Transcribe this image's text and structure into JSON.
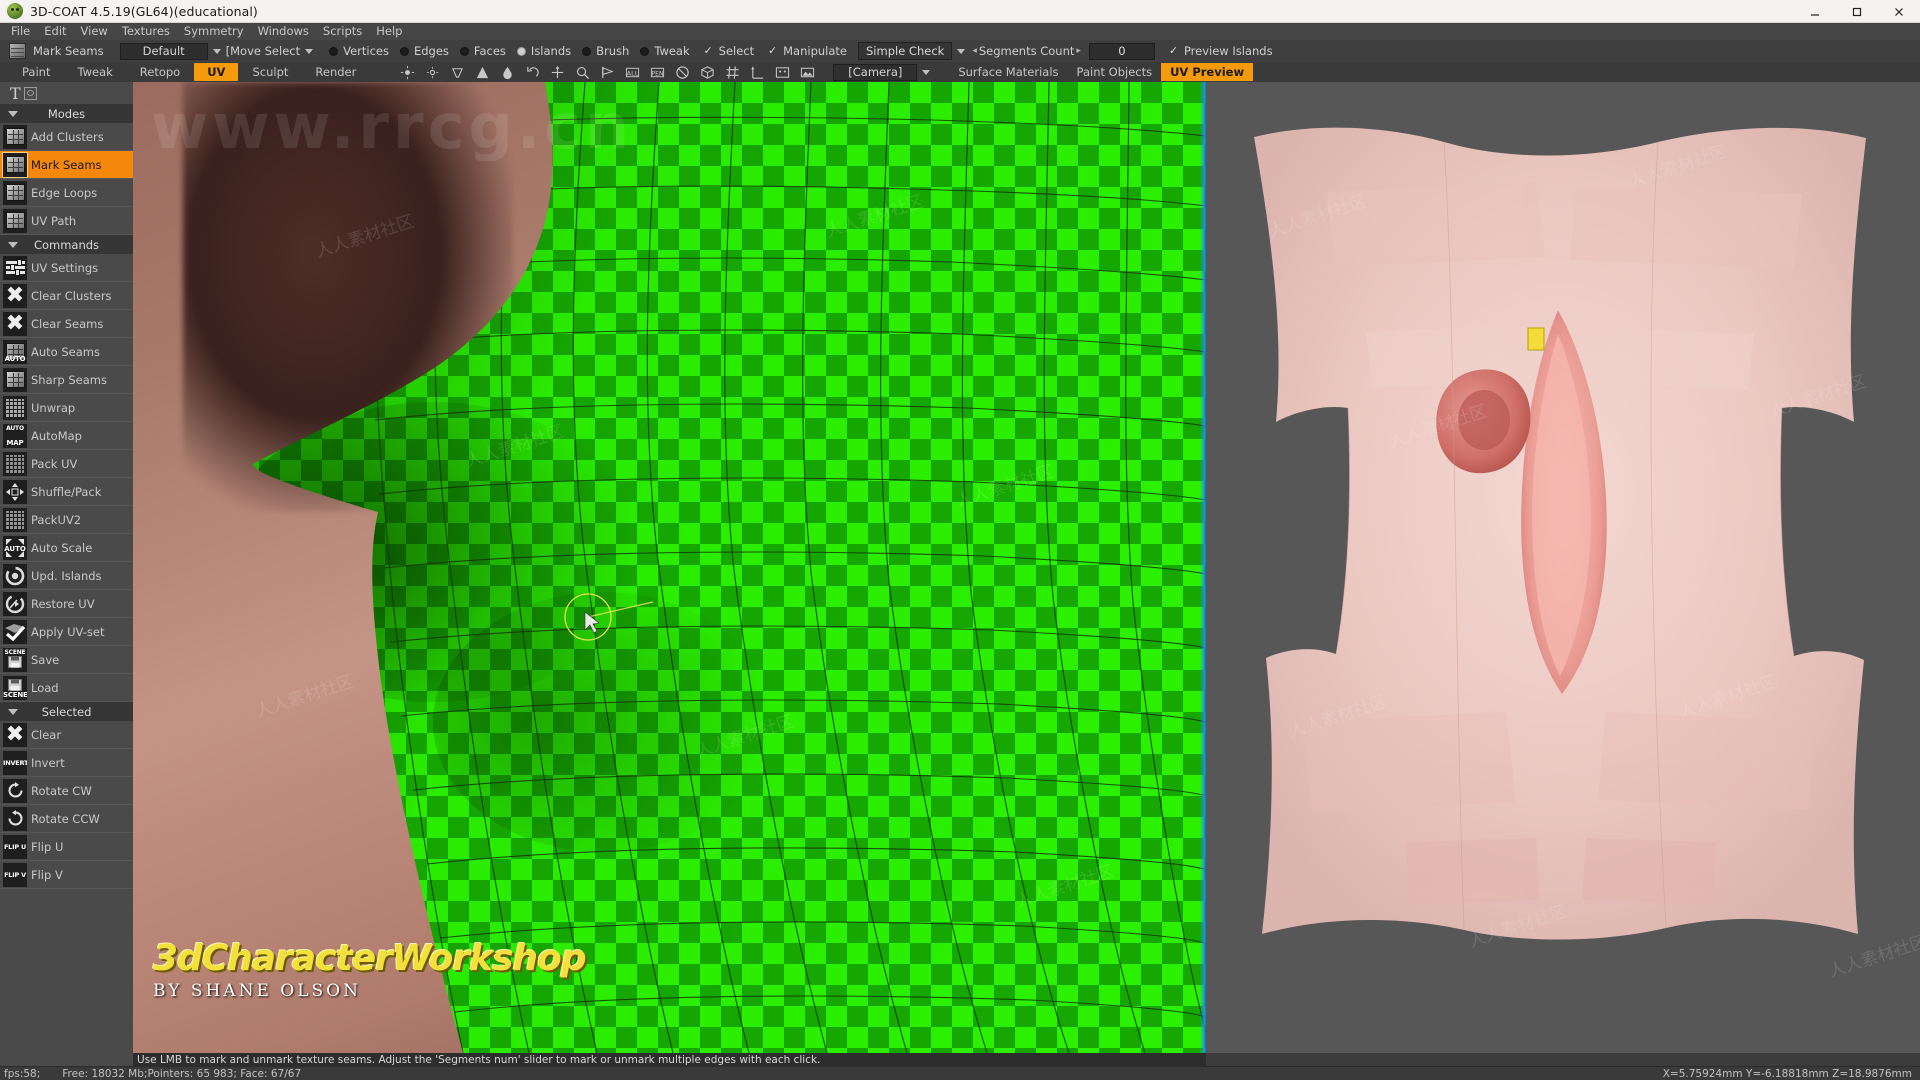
{
  "window": {
    "title": "3D-COAT 4.5.19(GL64)(educational)",
    "app_icon": "3dcoat-logo-icon",
    "minimize": "minimize-icon",
    "maximize": "maximize-icon",
    "close": "close-icon"
  },
  "menubar": {
    "items": [
      {
        "label": "File"
      },
      {
        "label": "Edit"
      },
      {
        "label": "View"
      },
      {
        "label": "Textures"
      },
      {
        "label": "Symmetry"
      },
      {
        "label": "Windows"
      },
      {
        "label": "Scripts"
      },
      {
        "label": "Help"
      }
    ]
  },
  "toolbar_top": {
    "tool_icon": "cube-tool-icon",
    "tool_name": "Mark Seams",
    "preset_combo": "Default",
    "transform_combo": "[Move Select",
    "selection_modes": [
      {
        "label": "Vertices",
        "selected": false
      },
      {
        "label": "Edges",
        "selected": false
      },
      {
        "label": "Faces",
        "selected": false
      },
      {
        "label": "Islands",
        "selected": true
      },
      {
        "label": "Brush",
        "selected": false
      },
      {
        "label": "Tweak",
        "selected": false
      }
    ],
    "checkboxes": [
      {
        "label": "Select",
        "checked": true
      },
      {
        "label": "Manipulate",
        "checked": true
      }
    ],
    "check_combo": "Simple Check",
    "segments_label": "Segments Count",
    "segments_value": "0",
    "preview_islands": {
      "label": "Preview Islands",
      "checked": true
    }
  },
  "toolbar_rooms": {
    "rooms": [
      {
        "label": "Paint",
        "active": false
      },
      {
        "label": "Tweak",
        "active": false
      },
      {
        "label": "Retopo",
        "active": false
      },
      {
        "label": "UV",
        "active": true
      },
      {
        "label": "Sculpt",
        "active": false
      },
      {
        "label": "Render",
        "active": false
      }
    ],
    "icons": [
      "light-icon",
      "light-dim-icon",
      "light-spot-icon",
      "cone-icon",
      "water-drop-icon",
      "undo-icon",
      "redo-icon",
      "move-axis-icon",
      "magnifier-icon",
      "flag-icon",
      "plane-all-icon",
      "plane-pen-icon",
      "no-symmetry-icon",
      "box-icon",
      "grid-icon",
      "axis-icon",
      "screen-icon",
      "image-icon"
    ],
    "camera_combo": "[Camera]",
    "view_tabs": [
      {
        "label": "Surface Materials",
        "active": false
      },
      {
        "label": "Paint Objects",
        "active": false
      },
      {
        "label": "UV Preview",
        "active": true
      }
    ]
  },
  "sidebar": {
    "logo_glyph": "T",
    "sections": [
      {
        "title": "Modes",
        "items": [
          {
            "label": "Add Clusters",
            "icon": "cube-cluster-icon",
            "active": false
          },
          {
            "label": "Mark Seams",
            "icon": "cube-seam-icon",
            "active": true
          },
          {
            "label": "Edge Loops",
            "icon": "cube-loop-icon",
            "active": false
          },
          {
            "label": "UV Path",
            "icon": "cube-path-icon",
            "active": false
          }
        ]
      },
      {
        "title": "Commands",
        "items": [
          {
            "label": "UV Settings",
            "icon": "sliders-icon",
            "active": false
          },
          {
            "label": "Clear Clusters",
            "icon": "x-cross-icon",
            "active": false
          },
          {
            "label": "Clear Seams",
            "icon": "x-cross-icon",
            "active": false
          },
          {
            "label": "Auto Seams",
            "icon": "auto-seams-icon",
            "active": false
          },
          {
            "label": "Sharp Seams",
            "icon": "sharp-seams-icon",
            "active": false
          },
          {
            "label": "Unwrap",
            "icon": "grid-unwrap-icon",
            "active": false
          },
          {
            "label": "AutoMap",
            "icon": "automap-icon",
            "active": false
          },
          {
            "label": "Pack UV",
            "icon": "pack-uv-icon",
            "active": false
          },
          {
            "label": "Shuffle/Pack",
            "icon": "shuffle-pack-icon",
            "active": false
          },
          {
            "label": "PackUV2",
            "icon": "packuv2-icon",
            "active": false
          },
          {
            "label": "Auto Scale",
            "icon": "auto-scale-icon",
            "active": false
          },
          {
            "label": "Upd. Islands",
            "icon": "update-islands-icon",
            "active": false
          },
          {
            "label": "Restore UV",
            "icon": "restore-uv-icon",
            "active": false
          },
          {
            "label": "Apply UV-set",
            "icon": "apply-uvset-icon",
            "active": false
          },
          {
            "label": "Save",
            "icon": "save-scene-icon",
            "active": false
          },
          {
            "label": "Load",
            "icon": "load-scene-icon",
            "active": false
          }
        ]
      },
      {
        "title": "Selected",
        "items": [
          {
            "label": "Clear",
            "icon": "x-cross-icon",
            "active": false
          },
          {
            "label": "Invert",
            "icon": "invert-icon",
            "active": false
          },
          {
            "label": "Rotate CW",
            "icon": "rotate-cw-icon",
            "active": false
          },
          {
            "label": "Rotate CCW",
            "icon": "rotate-ccw-icon",
            "active": false
          },
          {
            "label": "Flip U",
            "icon": "flip-u-icon",
            "active": false
          },
          {
            "label": "Flip V",
            "icon": "flip-v-icon",
            "active": false
          }
        ]
      }
    ]
  },
  "viewport": {
    "brand_title": "3dCharacterWorkshop",
    "brand_subtitle": "BY SHANE OLSON",
    "watermark_text": "人人素材社区",
    "watermark_url": "www.rrcg.cn"
  },
  "hint": {
    "text": "Use LMB to mark and unmark texture seams. Adjust the 'Segments num' slider to mark or unmark multiple edges with each click."
  },
  "statusbar": {
    "fps": "fps:58;",
    "memory": "Free: 18032 Mb;Pointers: 65 983; Face: 67/67",
    "coords": "X=5.75924mm Y=-6.18818mm Z=18.9876mm"
  }
}
